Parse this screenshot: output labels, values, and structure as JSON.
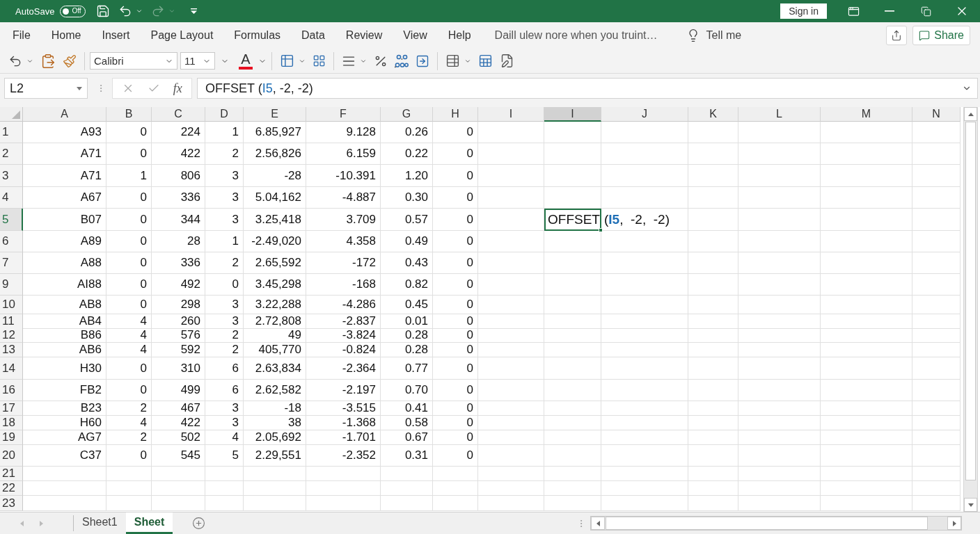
{
  "title_bar": {
    "autosave": {
      "label": "AutoSave",
      "on": false,
      "state_text": "Off"
    },
    "quick_access": [
      {
        "kind": "save",
        "disabled": false
      },
      {
        "kind": "undo",
        "disabled": false
      },
      {
        "kind": "redo",
        "disabled": true
      }
    ],
    "sign_in": "Sign in"
  },
  "ribbon": {
    "tabs": [
      "File",
      "Home",
      "Insert",
      "Page Layout",
      "Formulas",
      "Data",
      "Review",
      "View",
      "Help"
    ],
    "tip": "Daill ulew nore when you truint…",
    "tell_me": "Tell me",
    "share": "Share"
  },
  "toolbar": {
    "font": "Calibri",
    "font_size": "11",
    "font_color_glyph": "A"
  },
  "formula_bar": {
    "name_box": "L2",
    "function_label": "fx",
    "formula": [
      {
        "text": "OFFSET (",
        "kind": "plain"
      },
      {
        "text": "I5",
        "kind": "ref"
      },
      {
        "text": ", -2, -2)",
        "kind": "plain"
      }
    ]
  },
  "columns": [
    {
      "label": "A",
      "selected": false
    },
    {
      "label": "B",
      "selected": false
    },
    {
      "label": "C",
      "selected": false
    },
    {
      "label": "D",
      "selected": false
    },
    {
      "label": "E",
      "selected": false
    },
    {
      "label": "F",
      "selected": false
    },
    {
      "label": "G",
      "selected": false
    },
    {
      "label": "H",
      "selected": false
    },
    {
      "label": "I",
      "selected": false
    },
    {
      "label": "I",
      "selected": true
    },
    {
      "label": "J",
      "selected": false
    },
    {
      "label": "K",
      "selected": false
    },
    {
      "label": "L",
      "selected": false
    },
    {
      "label": "M",
      "selected": false
    },
    {
      "label": "N",
      "selected": false
    }
  ],
  "rows": [
    {
      "label": "1",
      "selected": false,
      "cells": [
        "A93",
        "0",
        "224",
        "1",
        "6.85,927",
        "9.128",
        "0.26",
        "0"
      ]
    },
    {
      "label": "2",
      "selected": false,
      "cells": [
        "A71",
        "0",
        "422",
        "2",
        "2.56,826",
        "6.159",
        "0.22",
        "0"
      ]
    },
    {
      "label": "3",
      "selected": false,
      "cells": [
        "A71",
        "1",
        "806",
        "3",
        "-28",
        "-10.391",
        "1.20",
        "0"
      ]
    },
    {
      "label": "4",
      "selected": false,
      "cells": [
        "A67",
        "0",
        "336",
        "3",
        "5.04,162",
        "-4.887",
        "0.30",
        "0"
      ]
    },
    {
      "label": "5",
      "selected": true,
      "cells": [
        "B07",
        "0",
        "344",
        "3",
        "3.25,418",
        "3.709",
        "0.57",
        "0"
      ],
      "active_cell_text": "OFFSET",
      "spill_text": [
        {
          "text": "(",
          "kind": "plain"
        },
        {
          "text": "I5",
          "kind": "ref"
        },
        {
          "text": ",  -2,  -2)",
          "kind": "plain"
        }
      ]
    },
    {
      "label": "6",
      "selected": false,
      "cells": [
        "A89",
        "0",
        "28",
        "1",
        "-2.49,020",
        "4.358",
        "0.49",
        "0"
      ]
    },
    {
      "label": "7",
      "selected": false,
      "cells": [
        "A88",
        "0",
        "336",
        "2",
        "2.65,592",
        "-172",
        "0.43",
        "0"
      ]
    },
    {
      "label": "9",
      "selected": false,
      "cells": [
        "AI88",
        "0",
        "492",
        "0",
        "3.45,298",
        "-168",
        "0.82",
        "0"
      ]
    },
    {
      "label": "10",
      "selected": false,
      "cells": [
        "AB8",
        "0",
        "298",
        "3",
        "3.22,288",
        "-4.286",
        "0.45",
        "0"
      ]
    },
    {
      "label": "11",
      "selected": false,
      "cells": [
        "AB4",
        "4",
        "260",
        "3",
        "2.72,808",
        "-2.837",
        "0.01",
        "0"
      ]
    },
    {
      "label": "12",
      "selected": false,
      "cells": [
        "B86",
        "4",
        "576",
        "2",
        "49",
        "-3.824",
        "0.28",
        "0"
      ]
    },
    {
      "label": "13",
      "selected": false,
      "cells": [
        "AB6",
        "4",
        "592",
        "2",
        "405,770",
        "-0.824",
        "0.28",
        "0"
      ]
    },
    {
      "label": "14",
      "selected": false,
      "cells": [
        "H30",
        "0",
        "310",
        "6",
        "2.63,834",
        "-2.364",
        "0.77",
        "0"
      ]
    },
    {
      "label": "16",
      "selected": false,
      "cells": [
        "FB2",
        "0",
        "499",
        "6",
        "2.62,582",
        "-2.197",
        "0.70",
        "0"
      ]
    },
    {
      "label": "17",
      "selected": false,
      "cells": [
        "B23",
        "2",
        "467",
        "3",
        "-18",
        "-3.515",
        "0.41",
        "0"
      ]
    },
    {
      "label": "18",
      "selected": false,
      "cells": [
        "H60",
        "4",
        "422",
        "3",
        "38",
        "-1.368",
        "0.58",
        "0"
      ]
    },
    {
      "label": "19",
      "selected": false,
      "cells": [
        "AG7",
        "2",
        "502",
        "4",
        "2.05,692",
        "-1.701",
        "0.67",
        "0"
      ]
    },
    {
      "label": "20",
      "selected": false,
      "cells": [
        "C37",
        "0",
        "545",
        "5",
        "2.29,551",
        "-2.352",
        "0.31",
        "0"
      ]
    },
    {
      "label": "21",
      "selected": false
    },
    {
      "label": "22",
      "selected": false
    },
    {
      "label": "23",
      "selected": false
    }
  ],
  "sheet_tabs": [
    {
      "label": "Sheet1",
      "selected": false
    },
    {
      "label": "Sheet",
      "selected": true
    }
  ]
}
